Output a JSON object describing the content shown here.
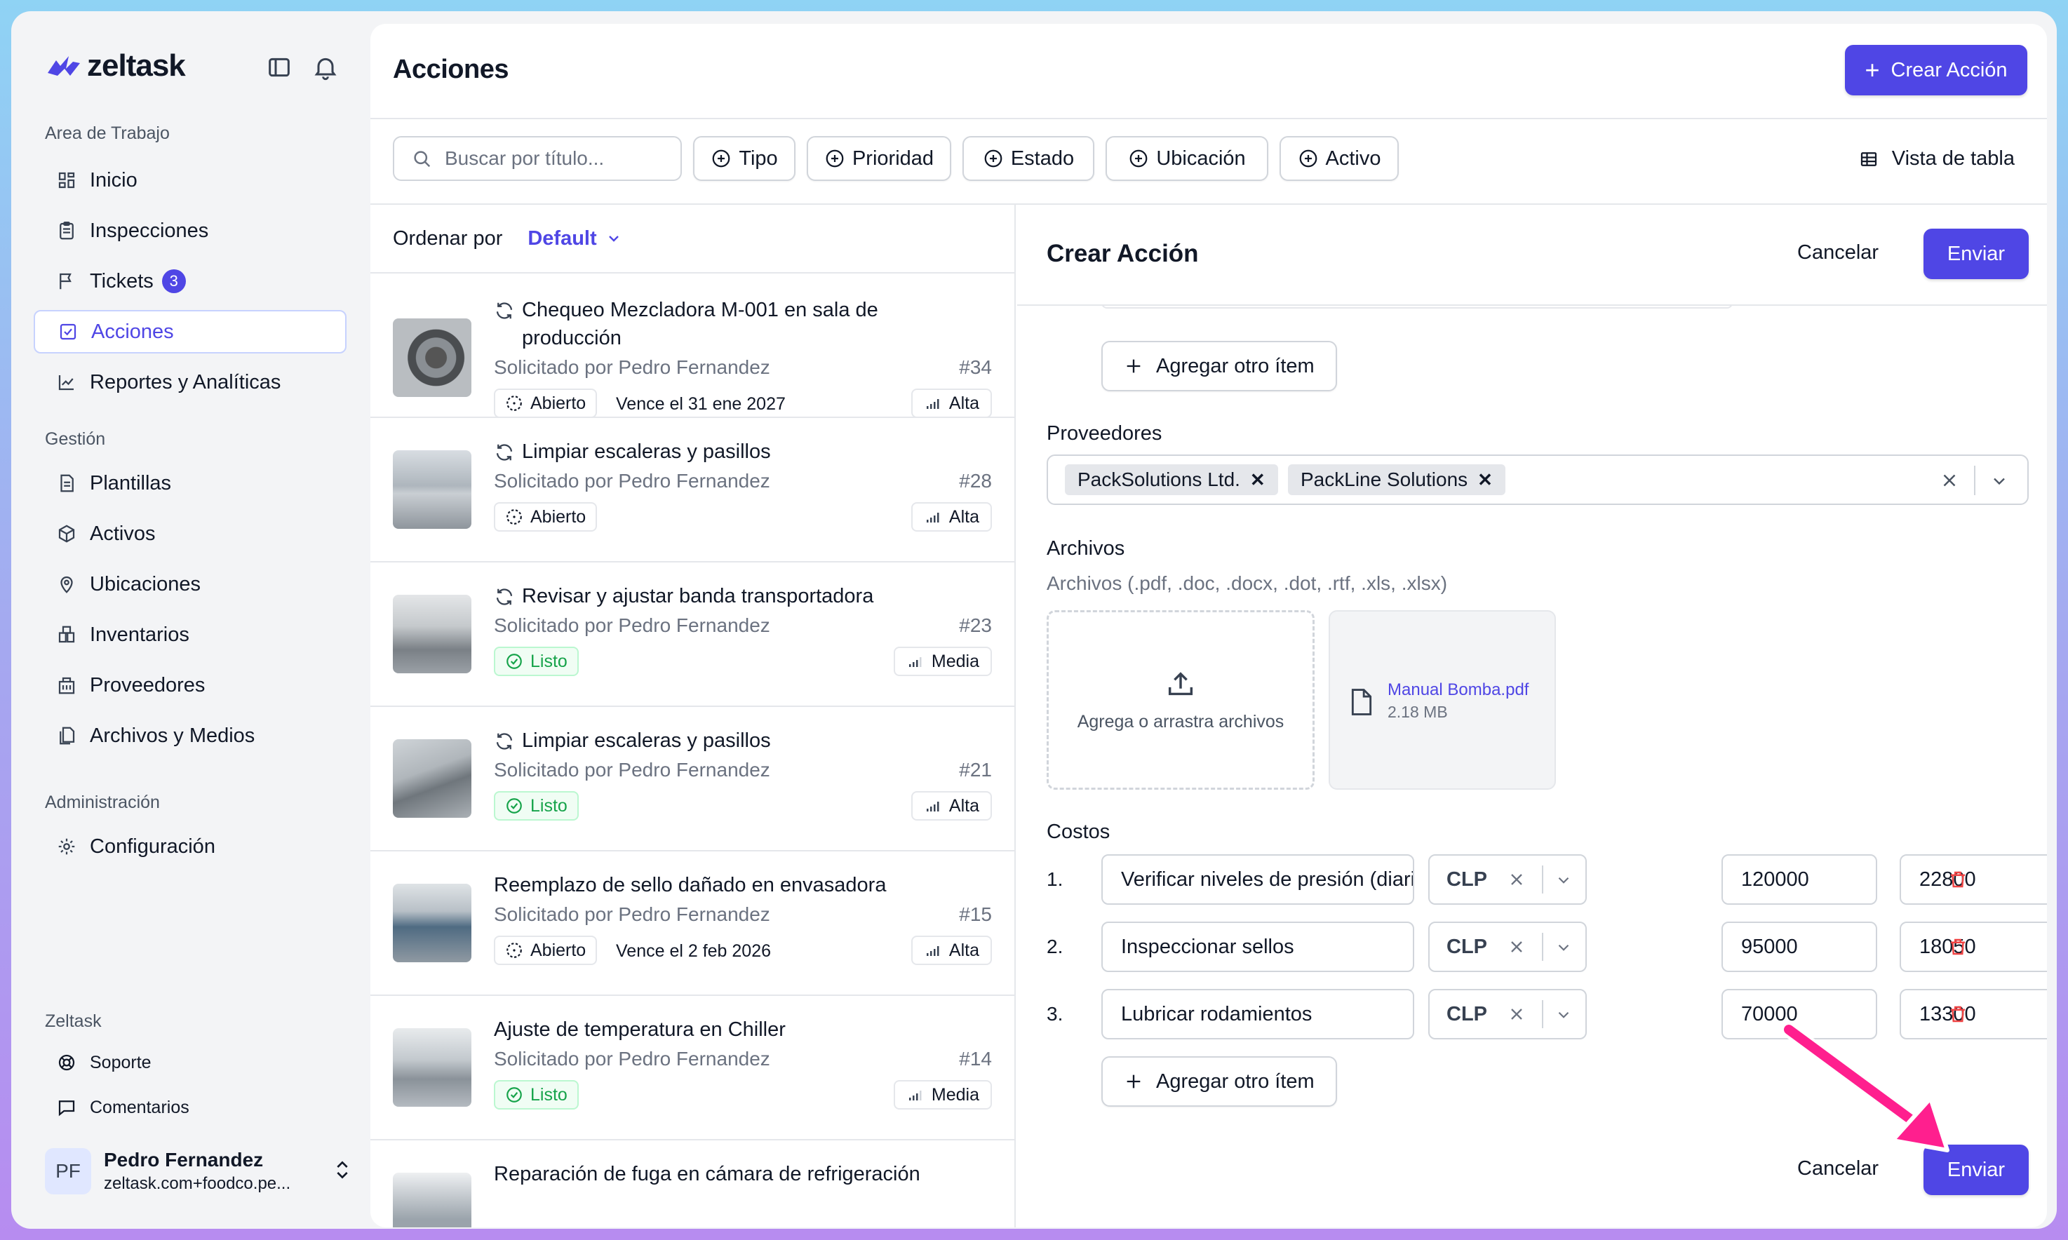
{
  "app": {
    "name": "zeltask"
  },
  "sidebar": {
    "workspace_label": "Area de Trabajo",
    "workspace_items": [
      {
        "label": "Inicio",
        "icon": "grid-icon"
      },
      {
        "label": "Inspecciones",
        "icon": "clipboard-icon"
      },
      {
        "label": "Tickets",
        "icon": "flag-icon",
        "badge": "3"
      },
      {
        "label": "Acciones",
        "icon": "check-square-icon",
        "active": true
      },
      {
        "label": "Reportes y Analíticas",
        "icon": "chart-line-icon"
      }
    ],
    "management_label": "Gestión",
    "management_items": [
      {
        "label": "Plantillas",
        "icon": "document-icon"
      },
      {
        "label": "Activos",
        "icon": "box-icon"
      },
      {
        "label": "Ubicaciones",
        "icon": "map-pin-icon"
      },
      {
        "label": "Inventarios",
        "icon": "inventory-icon"
      },
      {
        "label": "Proveedores",
        "icon": "building-icon"
      },
      {
        "label": "Archivos y Medios",
        "icon": "files-icon"
      }
    ],
    "admin_label": "Administración",
    "admin_items": [
      {
        "label": "Configuración",
        "icon": "gear-icon"
      }
    ],
    "footer_label": "Zeltask",
    "footer_items": [
      {
        "label": "Soporte",
        "icon": "lifebuoy-icon"
      },
      {
        "label": "Comentarios",
        "icon": "comment-icon"
      }
    ],
    "user": {
      "initials": "PF",
      "name": "Pedro Fernandez",
      "email": "zeltask.com+foodco.pe..."
    }
  },
  "header": {
    "title": "Acciones",
    "create_button": "Crear Acción"
  },
  "toolbar": {
    "search_placeholder": "Buscar por título...",
    "filters": [
      "Tipo",
      "Prioridad",
      "Estado",
      "Ubicación",
      "Activo"
    ],
    "view_toggle": "Vista de tabla"
  },
  "list": {
    "sort_label": "Ordenar por",
    "sort_value": "Default",
    "items": [
      {
        "title": "Chequeo Mezcladora M-001 en sala de producción",
        "recurring": true,
        "requested_by": "Solicitado por Pedro Fernandez",
        "number": "#34",
        "status": "Abierto",
        "due": "Vence el 31 ene 2027",
        "priority": "Alta"
      },
      {
        "title": "Limpiar escaleras y pasillos",
        "recurring": true,
        "requested_by": "Solicitado por Pedro Fernandez",
        "number": "#28",
        "status": "Abierto",
        "due": "",
        "priority": "Alta"
      },
      {
        "title": "Revisar y ajustar banda transportadora",
        "recurring": true,
        "requested_by": "Solicitado por Pedro Fernandez",
        "number": "#23",
        "status": "Listo",
        "due": "",
        "priority": "Media"
      },
      {
        "title": "Limpiar escaleras y pasillos",
        "recurring": true,
        "requested_by": "Solicitado por Pedro Fernandez",
        "number": "#21",
        "status": "Listo",
        "due": "",
        "priority": "Alta"
      },
      {
        "title": "Reemplazo de sello dañado en envasadora",
        "recurring": false,
        "requested_by": "Solicitado por Pedro Fernandez",
        "number": "#15",
        "status": "Abierto",
        "due": "Vence el 2 feb 2026",
        "priority": "Alta"
      },
      {
        "title": "Ajuste de temperatura en Chiller",
        "recurring": false,
        "requested_by": "Solicitado por Pedro Fernandez",
        "number": "#14",
        "status": "Listo",
        "due": "",
        "priority": "Media"
      },
      {
        "title": "Reparación de fuga en cámara de refrigeración",
        "recurring": false,
        "requested_by": "",
        "number": "",
        "status": "",
        "due": "",
        "priority": ""
      }
    ]
  },
  "form": {
    "title": "Crear Acción",
    "cancel": "Cancelar",
    "submit": "Enviar",
    "add_item": "Agregar otro ítem",
    "suppliers_label": "Proveedores",
    "suppliers": [
      "PackSolutions Ltd.",
      "PackLine Solutions"
    ],
    "files_label": "Archivos",
    "files_help": "Archivos (.pdf, .doc, .docx, .dot, .rtf, .xls, .xlsx)",
    "dropzone": "Agrega o arrastra archivos",
    "file": {
      "name": "Manual Bomba.pdf",
      "size": "2.18 MB"
    },
    "costs_label": "Costos",
    "costs": [
      {
        "n": "1.",
        "desc": "Verificar niveles de presión (diario)",
        "currency": "CLP",
        "amount": "120000",
        "tax": "22800"
      },
      {
        "n": "2.",
        "desc": "Inspeccionar sellos",
        "currency": "CLP",
        "amount": "95000",
        "tax": "18050"
      },
      {
        "n": "3.",
        "desc": "Lubricar rodamientos",
        "currency": "CLP",
        "amount": "70000",
        "tax": "13300"
      }
    ]
  },
  "colors": {
    "accent": "#4f46e5",
    "success": "#16a34a",
    "danger": "#ef4444",
    "annotation": "#ff1f8e"
  }
}
